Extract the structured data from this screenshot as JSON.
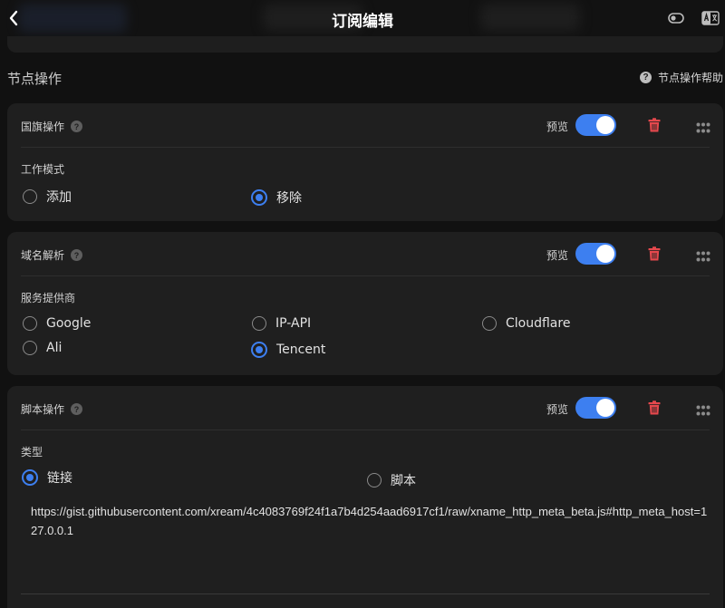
{
  "header": {
    "title": "订阅编辑"
  },
  "section": {
    "title": "节点操作",
    "help_label": "节点操作帮助"
  },
  "cards": [
    {
      "title": "国旗操作",
      "preview_label": "预览",
      "preview_enabled": true,
      "field_label": "工作模式",
      "options": [
        "添加",
        "移除"
      ],
      "selected": "移除"
    },
    {
      "title": "域名解析",
      "preview_label": "预览",
      "preview_enabled": true,
      "field_label": "服务提供商",
      "options": [
        "Google",
        "IP-API",
        "Cloudflare",
        "Ali",
        "Tencent"
      ],
      "selected": "Tencent"
    },
    {
      "title": "脚本操作",
      "preview_label": "预览",
      "preview_enabled": true,
      "field_label": "类型",
      "options": [
        "链接",
        "脚本"
      ],
      "selected": "链接",
      "value": "https://gist.githubusercontent.com/xream/4c4083769f24f1a7b4d254aad6917cf1/raw/xname_http_meta_beta.js#http_meta_host=127.0.0.1"
    }
  ],
  "icons": {
    "back": "chevron-left-icon",
    "help": "question-circle-icon",
    "delete": "trash-icon",
    "drag": "grip-dots-icon"
  },
  "colors": {
    "accent": "#3d7ff0",
    "danger": "#e5484d",
    "background": "#111111",
    "card": "#1f1f1f"
  }
}
